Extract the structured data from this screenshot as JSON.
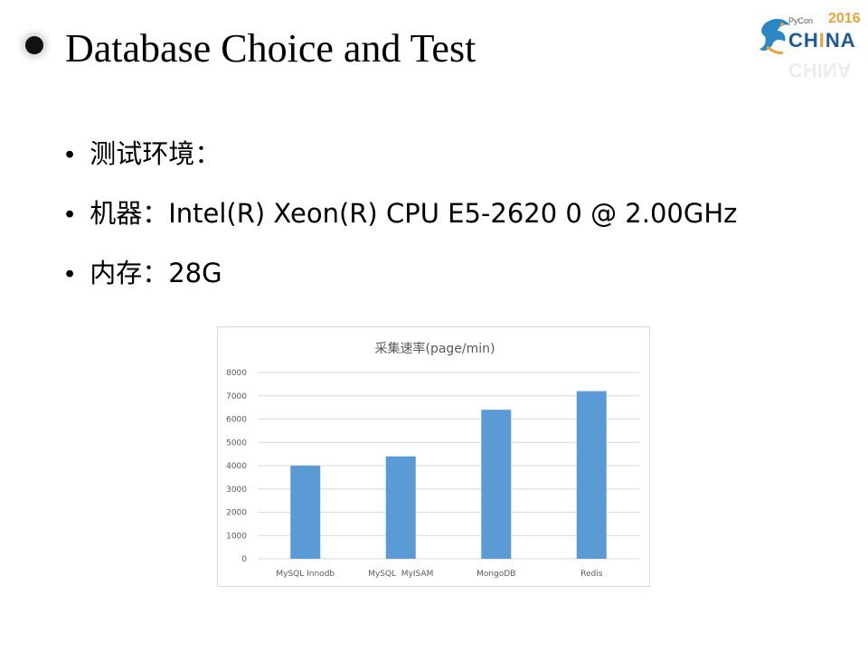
{
  "slide": {
    "title": "Database Choice and Test",
    "bullets": [
      {
        "label": "测试环境：",
        "value": ""
      },
      {
        "label": "机器：",
        "value": "Intel(R) Xeon(R) CPU E5-2620 0 @ 2.00GHz"
      },
      {
        "label": "内存：",
        "value": "28G"
      }
    ]
  },
  "logo": {
    "pycon": "PyCon",
    "year": "2016",
    "china": "CHINA",
    "colors": {
      "year": "#e8a23c",
      "text": "#1e5a96"
    }
  },
  "chart_data": {
    "type": "bar",
    "title": "采集速率(page/min)",
    "categories": [
      "MySQL Innodb",
      "MySQL  MyISAM",
      "MongoDB",
      "Redis"
    ],
    "values": [
      4000,
      4400,
      6400,
      7200
    ],
    "yticks": [
      0,
      1000,
      2000,
      3000,
      4000,
      5000,
      6000,
      7000,
      8000
    ],
    "ylim": [
      0,
      8000
    ],
    "grid": true,
    "color": "#5b9bd5"
  }
}
